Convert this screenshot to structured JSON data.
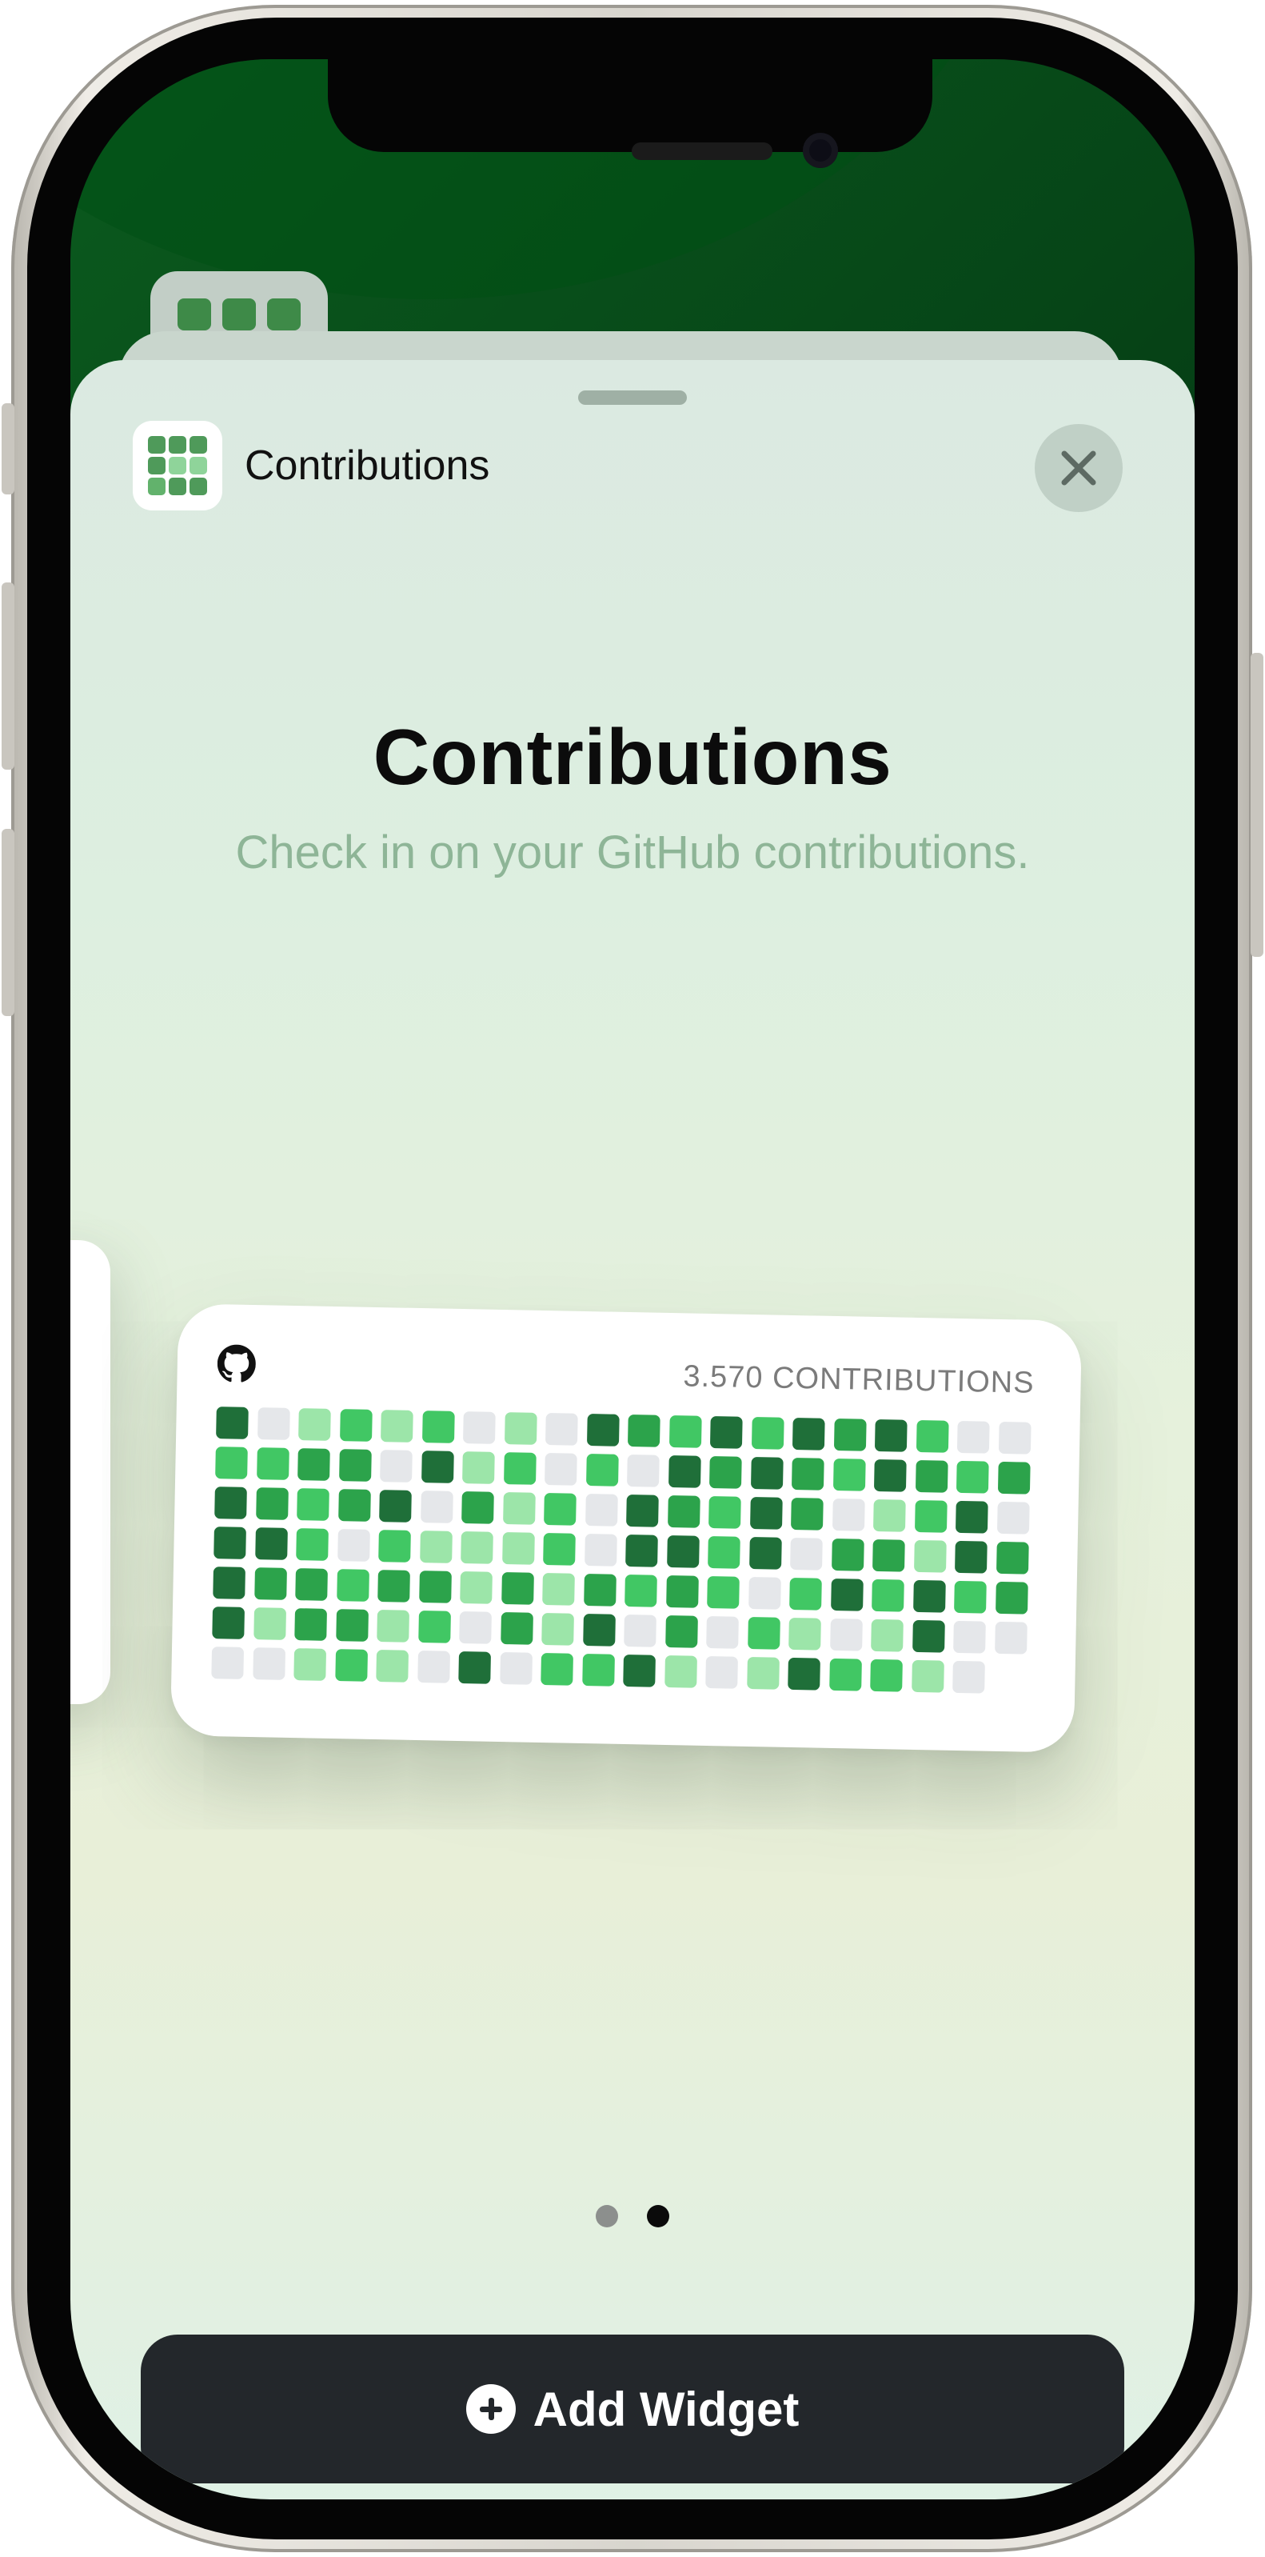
{
  "app": {
    "name": "Contributions"
  },
  "sheet": {
    "title": "Contributions",
    "description": "Check in on your GitHub contributions.",
    "close_icon": "close-icon"
  },
  "widget": {
    "icon": "github-icon",
    "contributions_label": "3.570 CONTRIBUTIONS",
    "colors": {
      "0": "#e5e7ea",
      "1": "#9ce5a9",
      "2": "#41c764",
      "3": "#2ca34b",
      "4": "#1f6f39"
    },
    "heatmap": [
      [
        4,
        0,
        1,
        2,
        1,
        2,
        0,
        1,
        0,
        4,
        3,
        2,
        4,
        2,
        4,
        3,
        4,
        2,
        0,
        0
      ],
      [
        2,
        2,
        3,
        3,
        0,
        4,
        1,
        2,
        0,
        2,
        0,
        4,
        3,
        4,
        3,
        2,
        4,
        3,
        2,
        3
      ],
      [
        4,
        3,
        2,
        3,
        4,
        0,
        3,
        1,
        2,
        0,
        4,
        3,
        2,
        4,
        3,
        0,
        1,
        2,
        4,
        0
      ],
      [
        4,
        4,
        2,
        0,
        2,
        1,
        1,
        1,
        2,
        0,
        4,
        4,
        2,
        4,
        0,
        3,
        3,
        1,
        4,
        3
      ],
      [
        4,
        3,
        3,
        2,
        3,
        3,
        1,
        3,
        1,
        3,
        2,
        3,
        2,
        0,
        2,
        4,
        2,
        4,
        2,
        3
      ],
      [
        4,
        1,
        3,
        3,
        1,
        2,
        0,
        3,
        1,
        4,
        0,
        3,
        0,
        2,
        1,
        0,
        1,
        4,
        0,
        0
      ],
      [
        0,
        0,
        1,
        2,
        1,
        0,
        4,
        0,
        2,
        2,
        4,
        1,
        0,
        1,
        4,
        2,
        2,
        1,
        0,
        -1
      ]
    ]
  },
  "pager": {
    "pages": 2,
    "active_index": 1,
    "colors": {
      "inactive": "#8c8f8d",
      "active": "#0b0b0b"
    }
  },
  "actions": {
    "add_widget_label": "Add Widget",
    "add_icon": "plus-circle-icon"
  }
}
